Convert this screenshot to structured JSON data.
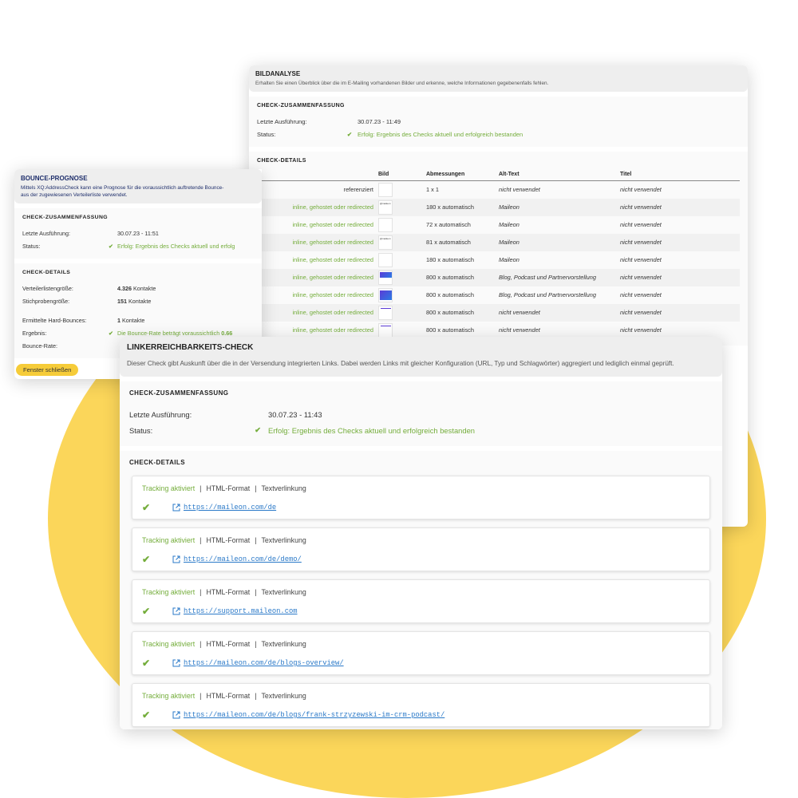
{
  "colors": {
    "accent": "#fbd65a",
    "success": "#74ad3b",
    "link": "#2a79c8",
    "button": "#f6cc39"
  },
  "bild": {
    "title": "BILDANALYSE",
    "description": "Erhalten Sie einen Überblick über die im E-Mailing vorhandenen Bilder und erkenne, welche Informationen gegebenenfalls fehlen.",
    "summary_title": "CHECK-ZUSAMMENFASSUNG",
    "last_run_label": "Letzte Ausführung:",
    "last_run_value": "30.07.23 - 11:49",
    "status_label": "Status:",
    "status_value": "Erfolg: Ergebnis des Checks aktuell und erfolgreich bestanden",
    "details_title": "CHECK-DETAILS",
    "columns": {
      "image": "Bild",
      "dimensions": "Abmessungen",
      "alt": "Alt-Text",
      "title": "Titel"
    },
    "rows": [
      {
        "usage": "referenziert",
        "thumb": "blank",
        "dims": "1 x 1",
        "alt": "nicht verwendet",
        "title": "nicht verwendet"
      },
      {
        "usage": "inline, gehostet oder redirected",
        "thumb": "logo",
        "dims": "180 x automatisch",
        "alt": "Maileon",
        "title": "nicht verwendet"
      },
      {
        "usage": "inline, gehostet oder redirected",
        "thumb": "blank",
        "dims": "72 x automatisch",
        "alt": "Maileon",
        "title": "nicht verwendet"
      },
      {
        "usage": "inline, gehostet oder redirected",
        "thumb": "logo",
        "dims": "81 x automatisch",
        "alt": "Maileon",
        "title": "nicht verwendet"
      },
      {
        "usage": "inline, gehostet oder redirected",
        "thumb": "blank",
        "dims": "180 x automatisch",
        "alt": "Maileon",
        "title": "nicht verwendet"
      },
      {
        "usage": "inline, gehostet oder redirected",
        "thumb": "banner-small",
        "dims": "800 x automatisch",
        "alt": "Blog, Podcast und Partnervorstellung",
        "title": "nicht verwendet"
      },
      {
        "usage": "inline, gehostet oder redirected",
        "thumb": "banner",
        "dims": "800 x automatisch",
        "alt": "Blog, Podcast und Partnervorstellung",
        "title": "nicht verwendet"
      },
      {
        "usage": "inline, gehostet oder redirected",
        "thumb": "line",
        "dims": "800 x automatisch",
        "alt": "nicht verwendet",
        "title": "nicht verwendet"
      },
      {
        "usage": "inline, gehostet oder redirected",
        "thumb": "line",
        "dims": "800 x automatisch",
        "alt": "nicht verwendet",
        "title": "nicht verwendet"
      }
    ]
  },
  "bounce": {
    "title": "BOUNCE-PROGNOSE",
    "desc_line1": "Mittels XQ:AddressCheck kann eine Prognose für die voraussichtlich auftretende Bounce-",
    "desc_line2": "aus der zugewiesenen Verteilerliste verwendet.",
    "summary_title": "CHECK-ZUSAMMENFASSUNG",
    "last_run_label": "Letzte Ausführung:",
    "last_run_value": "30.07.23 - 11:51",
    "status_label": "Status:",
    "status_value": "Erfolg: Ergebnis des Checks aktuell und erfolg",
    "details_title": "CHECK-DETAILS",
    "list_size_label": "Verteilerlistengröße:",
    "list_size_value": "4.326",
    "list_size_unit": "Kontakte",
    "sample_label": "Stichprobengröße:",
    "sample_value": "151",
    "sample_unit": "Kontakte",
    "hard_label": "Ermittelte Hard-Bounces:",
    "hard_value": "1",
    "hard_unit": "Kontakte",
    "result_label": "Ergebnis:",
    "result_value": "Die Bounce-Rate beträgt voraussichtlich",
    "result_number": "0.66",
    "rate_label": "Bounce-Rate:",
    "close_label": "Fenster schließen"
  },
  "link": {
    "title": "LINKERREICHBARKEITS-CHECK",
    "description": "Dieser Check gibt Auskunft über die in der Versendung integrierten Links. Dabei werden Links mit gleicher Konfiguration (URL, Typ und Schlagwörter) aggregiert und lediglich einmal geprüft.",
    "summary_title": "CHECK-ZUSAMMENFASSUNG",
    "last_run_label": "Letzte Ausführung:",
    "last_run_value": "30.07.23 - 11:43",
    "status_label": "Status:",
    "status_value": "Erfolg: Ergebnis des Checks aktuell und erfolgreich bestanden",
    "details_title": "CHECK-DETAILS",
    "items": [
      {
        "tracking": "Tracking aktiviert",
        "format": "HTML-Format",
        "type": "Textverlinkung",
        "url": "https://maileon.com/de"
      },
      {
        "tracking": "Tracking aktiviert",
        "format": "HTML-Format",
        "type": "Textverlinkung",
        "url": "https://maileon.com/de/demo/"
      },
      {
        "tracking": "Tracking aktiviert",
        "format": "HTML-Format",
        "type": "Textverlinkung",
        "url": "https://support.maileon.com"
      },
      {
        "tracking": "Tracking aktiviert",
        "format": "HTML-Format",
        "type": "Textverlinkung",
        "url": "https://maileon.com/de/blogs-overview/"
      },
      {
        "tracking": "Tracking aktiviert",
        "format": "HTML-Format",
        "type": "Textverlinkung",
        "url": "https://maileon.com/de/blogs/frank-strzyzewski-im-crm-podcast/"
      }
    ]
  }
}
